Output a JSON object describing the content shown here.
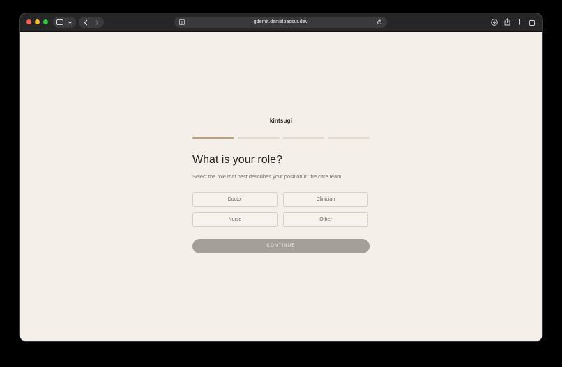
{
  "browser": {
    "url": "gdemit.danielbacsur.dev",
    "icons": {
      "close": "close-traffic-light",
      "minimize": "minimize-traffic-light",
      "maximize": "maximize-traffic-light",
      "sidebar": "sidebar-toggle-icon",
      "chevron": "chevron-down-icon",
      "back": "back-arrow-icon",
      "forward": "forward-arrow-icon",
      "reader": "reader-icon",
      "reload": "reload-icon",
      "download": "download-icon",
      "share": "share-icon",
      "new_tab": "plus-icon",
      "tabs": "tab-overview-icon"
    }
  },
  "page": {
    "brand": "kintsugi",
    "progress": {
      "current_step": 1,
      "total_steps": 4
    },
    "question": "What is your role?",
    "subtitle": "Select the role that best describes your position in the care team.",
    "options": [
      {
        "label": "Doctor"
      },
      {
        "label": "Clinician"
      },
      {
        "label": "Nurse"
      },
      {
        "label": "Other"
      }
    ],
    "continue_label": "CONTINUE",
    "colors": {
      "background": "#f5efe9",
      "accent": "#b7a280",
      "button_disabled": "#a39f9b"
    }
  }
}
